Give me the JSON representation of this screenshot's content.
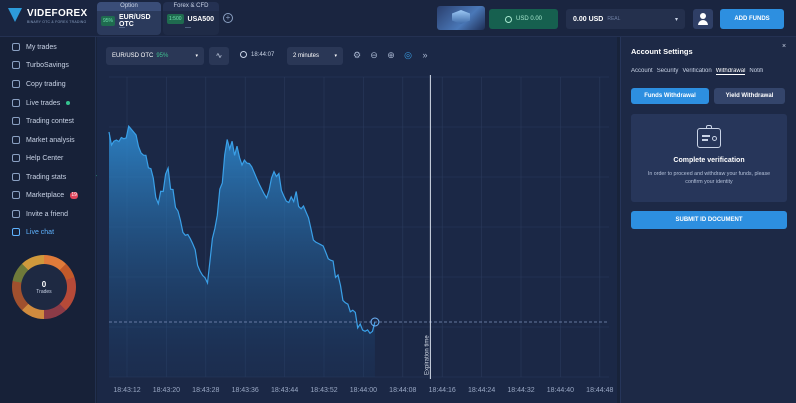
{
  "brand": {
    "name": "VIDEFOREX",
    "tagline": "BINARY OTC & FOREX TRADING"
  },
  "tabs": [
    {
      "category": "Option",
      "payout": "95%",
      "asset": "EUR/USD OTC",
      "sub": "—"
    },
    {
      "category": "Forex & CFD",
      "payout": "1:500",
      "asset": "USA500",
      "sub": "—"
    }
  ],
  "header": {
    "balance_label": "USD 0.00",
    "account_amount": "0.00 USD",
    "account_type": "REAL",
    "add_funds_label": "ADD FUNDS",
    "add_tab_symbol": "+",
    "chevron": "▾"
  },
  "sidebar": {
    "items": [
      {
        "label": "My trades",
        "icon": "chart-icon"
      },
      {
        "label": "TurboSavings",
        "icon": "piggy-bank-icon"
      },
      {
        "label": "Copy trading",
        "icon": "copy-icon"
      },
      {
        "label": "Live trades",
        "icon": "live-icon"
      },
      {
        "label": "Trading contest",
        "icon": "trophy-icon"
      },
      {
        "label": "Market analysis",
        "icon": "analysis-icon"
      },
      {
        "label": "Help Center",
        "icon": "help-icon"
      },
      {
        "label": "Trading stats",
        "icon": "stats-icon"
      },
      {
        "label": "Marketplace",
        "icon": "cart-icon",
        "badge": "19"
      },
      {
        "label": "Invite a friend",
        "icon": "user-plus-icon"
      },
      {
        "label": "Live chat",
        "icon": "chat-icon"
      }
    ],
    "trades_count": "0",
    "trades_label": "Trades"
  },
  "chart": {
    "asset": "EUR/USD OTC",
    "payout": "95%",
    "time": "18:44:07",
    "interval": "2 minutes",
    "expiration_label": "Expiration time",
    "line_color": "#3aa0e8",
    "fill_color": "#2a7fc4",
    "grid_color": "#2a3a5c",
    "x_ticks": [
      "18:43:12",
      "18:43:20",
      "18:43:28",
      "18:43:36",
      "18:43:44",
      "18:43:52",
      "18:44:00",
      "18:44:08",
      "18:44:16",
      "18:44:24",
      "18:44:32",
      "18:44:40",
      "18:44:48"
    ]
  },
  "chart_data": {
    "type": "area",
    "title": "",
    "xlabel": "",
    "ylabel": "",
    "x": [
      "18:43:12",
      "18:43:14",
      "18:43:16",
      "18:43:18",
      "18:43:20",
      "18:43:22",
      "18:43:24",
      "18:43:26",
      "18:43:28",
      "18:43:30",
      "18:43:32",
      "18:43:34",
      "18:43:36",
      "18:43:38",
      "18:43:40",
      "18:43:42",
      "18:43:44",
      "18:43:46",
      "18:43:48",
      "18:43:50",
      "18:43:52",
      "18:43:54",
      "18:43:56",
      "18:43:58",
      "18:44:00",
      "18:44:02",
      "18:44:04",
      "18:44:06"
    ],
    "series": [
      {
        "values": [
          0.88,
          0.84,
          0.92,
          0.86,
          0.78,
          0.62,
          0.74,
          0.56,
          0.48,
          0.38,
          0.32,
          0.58,
          0.86,
          0.82,
          0.76,
          0.72,
          0.66,
          0.74,
          0.62,
          0.64,
          0.56,
          0.46,
          0.44,
          0.34,
          0.22,
          0.16,
          0.08,
          0.14
        ]
      }
    ],
    "ylim": [
      0,
      1
    ],
    "grid": true,
    "current_value": 0.14
  },
  "account_settings": {
    "title": "Account Settings",
    "close": "×",
    "tabs": [
      "Account",
      "Security",
      "Verification",
      "Withdrawal",
      "Notifi"
    ],
    "active_tab": "Withdrawal",
    "funds_withdrawal": "Funds Withdrawal",
    "yield_withdrawal": "Yield Withdrawal",
    "verify_title": "Complete verification",
    "verify_desc": "In order to proceed and withdraw your funds, please confirm your identity",
    "submit_label": "SUBMIT ID DOCUMENT"
  }
}
